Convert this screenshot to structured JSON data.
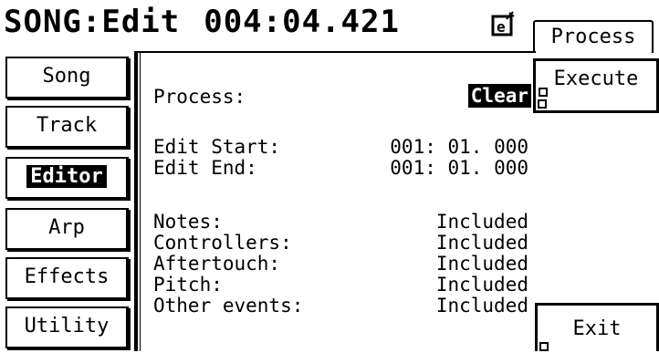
{
  "header": {
    "title": "SONG:Edit",
    "position": "004:04.421",
    "icon": "document-edit-icon"
  },
  "right_tabs": {
    "process_tab": "Process",
    "execute_button": "Execute",
    "exit_button": "Exit"
  },
  "sidebar": {
    "items": [
      {
        "label": "Song",
        "active": false
      },
      {
        "label": "Track",
        "active": false
      },
      {
        "label": "Editor",
        "active": true
      },
      {
        "label": "Arp",
        "active": false
      },
      {
        "label": "Effects",
        "active": false
      },
      {
        "label": "Utility",
        "active": false
      }
    ]
  },
  "main": {
    "process": {
      "label": "Process:",
      "value": "Clear"
    },
    "edit_start": {
      "label": "Edit Start:",
      "value": "001: 01. 000"
    },
    "edit_end": {
      "label": "Edit End:",
      "value": "001: 01. 000"
    },
    "events": [
      {
        "label": "Notes:",
        "value": "Included"
      },
      {
        "label": "Controllers:",
        "value": "Included"
      },
      {
        "label": "Aftertouch:",
        "value": "Included"
      },
      {
        "label": "Pitch:",
        "value": "Included"
      },
      {
        "label": "Other events:",
        "value": "Included"
      }
    ]
  }
}
